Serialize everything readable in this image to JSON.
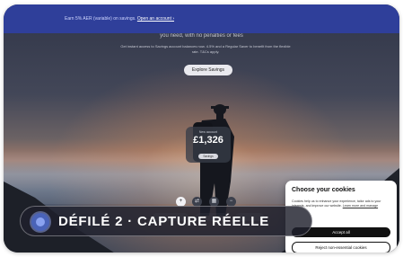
{
  "banner": {
    "text": "Earn 5% AER (variable) on savings.",
    "link": "Open an account ›"
  },
  "hero": {
    "title": "you need, with no penalties or fees",
    "subtitle": "Get instant access to Savings account balances now. 4.5% and a Regular Saver to benefit from the flexible rate. T&Cs apply.",
    "explore_label": "Explore Savings"
  },
  "savings_card": {
    "label": "New account",
    "amount": "£1,326",
    "chip": "Savings"
  },
  "controls": [
    {
      "icon": "plus-icon",
      "glyph": "+"
    },
    {
      "icon": "swap-icon",
      "glyph": "⇄"
    },
    {
      "icon": "bank-icon",
      "glyph": "▦"
    },
    {
      "icon": "minus-icon",
      "glyph": "−"
    }
  ],
  "overlay": {
    "label": "DÉFILÉ 2 · CAPTURE RÉELLE"
  },
  "cookie": {
    "title": "Choose your cookies",
    "body": "Cookies help us to enhance your experience, tailor ads to your interests, and improve our website.",
    "link": "Learn more and manage",
    "accept_label": "Accept all",
    "reject_label": "Reject non-essential cookies"
  },
  "colors": {
    "banner": "#2f3f9a",
    "overlay_dot": "#4a63b8",
    "accept_bg": "#111111"
  }
}
